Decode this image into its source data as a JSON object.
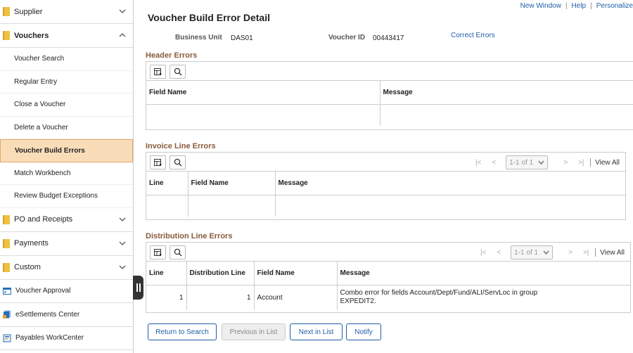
{
  "sidebar": {
    "supplier": "Supplier",
    "vouchers": "Vouchers",
    "voucher_items": [
      "Voucher Search",
      "Regular Entry",
      "Close a Voucher",
      "Delete a Voucher",
      "Voucher Build Errors",
      "Match Workbench",
      "Review Budget Exceptions"
    ],
    "po_receipts": "PO and Receipts",
    "payments": "Payments",
    "custom": "Custom",
    "voucher_approval": "Voucher Approval",
    "esettlements": "eSettlements Center",
    "payables_workcenter": "Payables WorkCenter"
  },
  "toplinks": {
    "new_window": "New Window",
    "help": "Help",
    "personalize": "Personalize"
  },
  "page": {
    "title": "Voucher Build Error Detail",
    "business_unit_label": "Business Unit",
    "business_unit_value": "DAS01",
    "voucher_id_label": "Voucher ID",
    "voucher_id_value": "00443417",
    "correct_errors": "Correct Errors"
  },
  "header_errors": {
    "title": "Header Errors",
    "columns": [
      "Field Name",
      "Message"
    ]
  },
  "invoice_line_errors": {
    "title": "Invoice Line Errors",
    "pager_text": "1-1 of 1",
    "view_all": "View All",
    "columns": [
      "Line",
      "Field Name",
      "Message"
    ]
  },
  "distribution_line_errors": {
    "title": "Distribution Line Errors",
    "pager_text": "1-1 of 1",
    "view_all": "View All",
    "columns": [
      "Line",
      "Distribution Line",
      "Field Name",
      "Message"
    ],
    "rows": [
      {
        "line": "1",
        "distribution_line": "1",
        "field_name": "Account",
        "message": "Combo error for fields Account/Dept/Fund/ALI/ServLoc in group EXPEDIT2."
      }
    ]
  },
  "buttons": {
    "return_to_search": "Return to Search",
    "previous_in_list": "Previous in List",
    "next_in_list": "Next in List",
    "notify": "Notify"
  },
  "colors": {
    "accent": "#1f5da8",
    "section_title": "#8a5a3b",
    "active_bg": "#f9ddb8",
    "folder": "#f0c040"
  }
}
